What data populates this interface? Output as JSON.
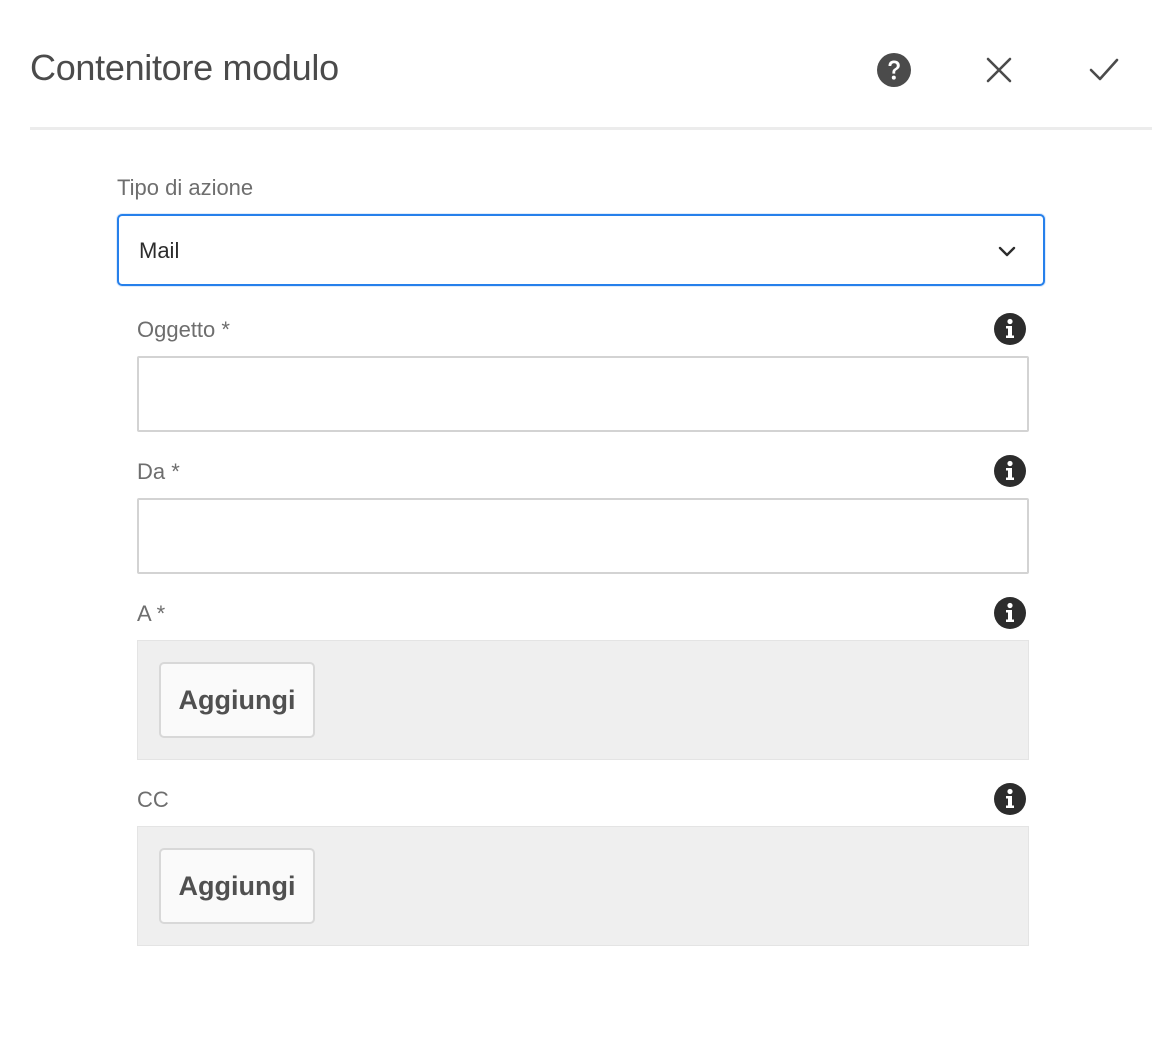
{
  "header": {
    "title": "Contenitore modulo",
    "help_icon": "help-circle-icon",
    "close_icon": "close-icon",
    "done_icon": "checkmark-icon"
  },
  "form": {
    "action_type": {
      "label": "Tipo di azione",
      "value": "Mail"
    },
    "subject": {
      "label": "Oggetto *",
      "value": "",
      "info_icon": "info-icon"
    },
    "from": {
      "label": "Da *",
      "value": "",
      "info_icon": "info-icon"
    },
    "to": {
      "label": "A *",
      "add_label": "Aggiungi",
      "info_icon": "info-icon"
    },
    "cc": {
      "label": "CC",
      "add_label": "Aggiungi",
      "info_icon": "info-icon"
    }
  },
  "colors": {
    "accent": "#2680eb",
    "text_label": "#6e6e6e",
    "icon_dark": "#2c2c2c",
    "panel_bg": "#efefef"
  }
}
